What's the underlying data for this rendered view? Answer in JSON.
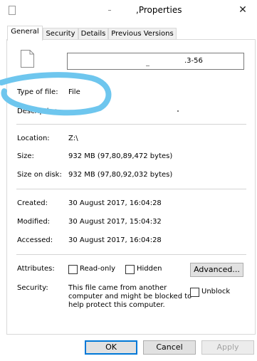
{
  "window": {
    "title": ",Properties",
    "close_glyph": "✕"
  },
  "tabs": [
    {
      "label": "General",
      "active": true
    },
    {
      "label": "Security",
      "active": false
    },
    {
      "label": "Details",
      "active": false
    },
    {
      "label": "Previous Versions",
      "active": false
    }
  ],
  "file_name": {
    "value": ".3-56"
  },
  "info": {
    "type_label": "Type of file:",
    "type_value": "File",
    "description_label": "Description:",
    "description_value": "",
    "location_label": "Location:",
    "location_value": "Z:\\",
    "size_label": "Size:",
    "size_value": "932 MB (97,80,89,472 bytes)",
    "size_on_disk_label": "Size on disk:",
    "size_on_disk_value": "932 MB (97,80,92,032 bytes)",
    "created_label": "Created:",
    "created_value": "30 August 2017, 16:04:28",
    "modified_label": "Modified:",
    "modified_value": "30 August 2017, 15:04:32",
    "accessed_label": "Accessed:",
    "accessed_value": "30 August 2017, 16:04:28"
  },
  "attributes": {
    "label": "Attributes:",
    "readonly_label": "Read-only",
    "readonly_checked": false,
    "hidden_label": "Hidden",
    "hidden_checked": false,
    "advanced_button": "Advanced..."
  },
  "security": {
    "label": "Security:",
    "note_lines": [
      "This file came from another",
      "computer and might be blocked to",
      "help protect this computer."
    ],
    "unblock_label": "Unblock",
    "unblock_checked": false
  },
  "buttons": {
    "ok": "OK",
    "cancel": "Cancel",
    "apply": "Apply"
  },
  "annotation": {
    "scribble_color": "#6ec6ee"
  }
}
